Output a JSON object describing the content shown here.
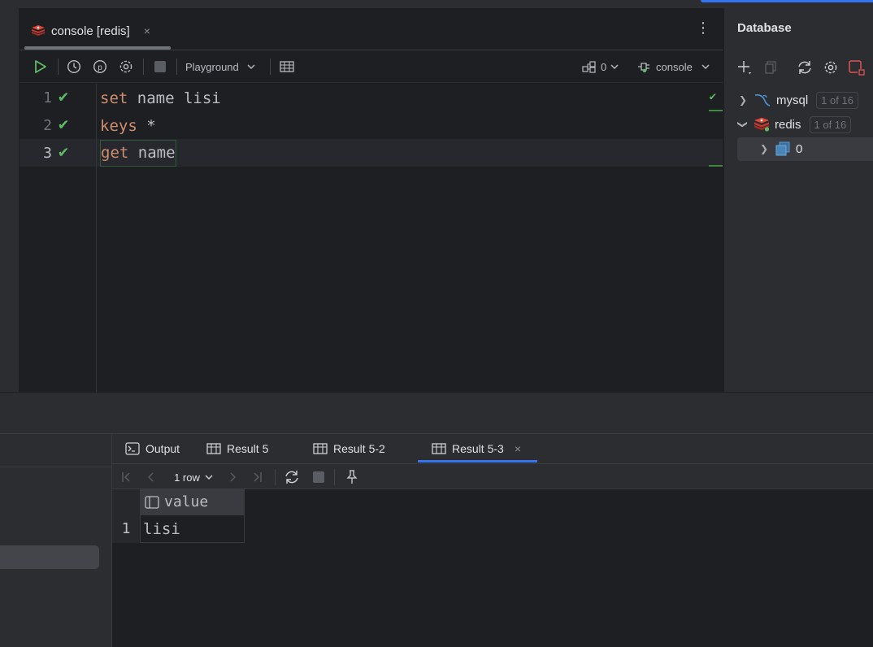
{
  "editor_tab": {
    "label": "console [redis]",
    "close_glyph": "×",
    "menu_glyph": "⋮",
    "icon": "redis-icon"
  },
  "toolbar": {
    "run_icon": "run-icon",
    "history_icon": "history-icon",
    "profile_icon": "p-icon",
    "settings_icon": "gear-icon",
    "stop_icon": "stop-icon",
    "mode_label": "Playground",
    "table_icon": "table-icon",
    "db_count": "0",
    "session_label": "console"
  },
  "code_lines": [
    {
      "number": "1",
      "keyword": "set",
      "rest": " name lisi",
      "status": "ok"
    },
    {
      "number": "2",
      "keyword": "keys",
      "rest": " *",
      "status": "ok"
    },
    {
      "number": "3",
      "keyword": "get",
      "rest": " name",
      "status": "ok"
    }
  ],
  "database_panel": {
    "title": "Database",
    "tree": [
      {
        "label": "mysql",
        "badge": "1 of 16",
        "expanded": false,
        "icon": "mysql-icon"
      },
      {
        "label": "redis",
        "badge": "1 of 16",
        "expanded": true,
        "icon": "redis-icon"
      },
      {
        "label": "0",
        "badge": "",
        "expanded": false,
        "icon": "database-schema-icon"
      }
    ]
  },
  "result_tabs": [
    {
      "label": "Output",
      "icon": "console-icon"
    },
    {
      "label": "Result 5",
      "icon": "table-icon"
    },
    {
      "label": "Result 5-2",
      "icon": "table-icon"
    },
    {
      "label": "Result 5-3",
      "icon": "table-icon",
      "active": true,
      "close_glyph": "×"
    }
  ],
  "result_toolbar": {
    "rows_label": "1 row"
  },
  "result_grid": {
    "columns": [
      "value"
    ],
    "rows": [
      {
        "number": "1",
        "cells": [
          "lisi"
        ]
      }
    ]
  },
  "colors": {
    "accent": "#3574f0",
    "success": "#5fb865",
    "keyword": "#cf8e6d",
    "redis": "#d83b2d"
  }
}
